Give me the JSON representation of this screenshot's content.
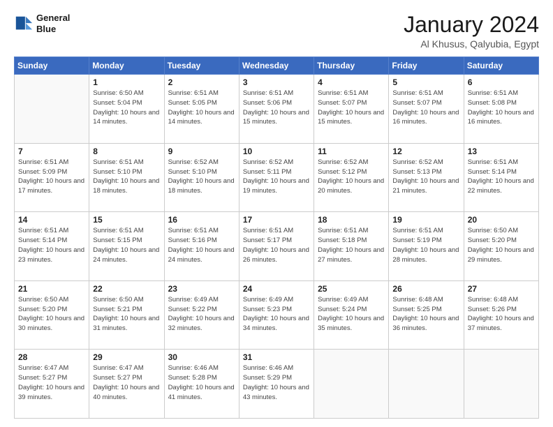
{
  "header": {
    "logo_line1": "General",
    "logo_line2": "Blue",
    "title": "January 2024",
    "subtitle": "Al Khusus, Qalyubia, Egypt"
  },
  "calendar": {
    "days_of_week": [
      "Sunday",
      "Monday",
      "Tuesday",
      "Wednesday",
      "Thursday",
      "Friday",
      "Saturday"
    ],
    "weeks": [
      [
        {
          "day": null,
          "info": null
        },
        {
          "day": "1",
          "info": "Sunrise: 6:50 AM\nSunset: 5:04 PM\nDaylight: 10 hours\nand 14 minutes."
        },
        {
          "day": "2",
          "info": "Sunrise: 6:51 AM\nSunset: 5:05 PM\nDaylight: 10 hours\nand 14 minutes."
        },
        {
          "day": "3",
          "info": "Sunrise: 6:51 AM\nSunset: 5:06 PM\nDaylight: 10 hours\nand 15 minutes."
        },
        {
          "day": "4",
          "info": "Sunrise: 6:51 AM\nSunset: 5:07 PM\nDaylight: 10 hours\nand 15 minutes."
        },
        {
          "day": "5",
          "info": "Sunrise: 6:51 AM\nSunset: 5:07 PM\nDaylight: 10 hours\nand 16 minutes."
        },
        {
          "day": "6",
          "info": "Sunrise: 6:51 AM\nSunset: 5:08 PM\nDaylight: 10 hours\nand 16 minutes."
        }
      ],
      [
        {
          "day": "7",
          "info": "Sunrise: 6:51 AM\nSunset: 5:09 PM\nDaylight: 10 hours\nand 17 minutes."
        },
        {
          "day": "8",
          "info": "Sunrise: 6:51 AM\nSunset: 5:10 PM\nDaylight: 10 hours\nand 18 minutes."
        },
        {
          "day": "9",
          "info": "Sunrise: 6:52 AM\nSunset: 5:10 PM\nDaylight: 10 hours\nand 18 minutes."
        },
        {
          "day": "10",
          "info": "Sunrise: 6:52 AM\nSunset: 5:11 PM\nDaylight: 10 hours\nand 19 minutes."
        },
        {
          "day": "11",
          "info": "Sunrise: 6:52 AM\nSunset: 5:12 PM\nDaylight: 10 hours\nand 20 minutes."
        },
        {
          "day": "12",
          "info": "Sunrise: 6:52 AM\nSunset: 5:13 PM\nDaylight: 10 hours\nand 21 minutes."
        },
        {
          "day": "13",
          "info": "Sunrise: 6:51 AM\nSunset: 5:14 PM\nDaylight: 10 hours\nand 22 minutes."
        }
      ],
      [
        {
          "day": "14",
          "info": "Sunrise: 6:51 AM\nSunset: 5:14 PM\nDaylight: 10 hours\nand 23 minutes."
        },
        {
          "day": "15",
          "info": "Sunrise: 6:51 AM\nSunset: 5:15 PM\nDaylight: 10 hours\nand 24 minutes."
        },
        {
          "day": "16",
          "info": "Sunrise: 6:51 AM\nSunset: 5:16 PM\nDaylight: 10 hours\nand 24 minutes."
        },
        {
          "day": "17",
          "info": "Sunrise: 6:51 AM\nSunset: 5:17 PM\nDaylight: 10 hours\nand 26 minutes."
        },
        {
          "day": "18",
          "info": "Sunrise: 6:51 AM\nSunset: 5:18 PM\nDaylight: 10 hours\nand 27 minutes."
        },
        {
          "day": "19",
          "info": "Sunrise: 6:51 AM\nSunset: 5:19 PM\nDaylight: 10 hours\nand 28 minutes."
        },
        {
          "day": "20",
          "info": "Sunrise: 6:50 AM\nSunset: 5:20 PM\nDaylight: 10 hours\nand 29 minutes."
        }
      ],
      [
        {
          "day": "21",
          "info": "Sunrise: 6:50 AM\nSunset: 5:20 PM\nDaylight: 10 hours\nand 30 minutes."
        },
        {
          "day": "22",
          "info": "Sunrise: 6:50 AM\nSunset: 5:21 PM\nDaylight: 10 hours\nand 31 minutes."
        },
        {
          "day": "23",
          "info": "Sunrise: 6:49 AM\nSunset: 5:22 PM\nDaylight: 10 hours\nand 32 minutes."
        },
        {
          "day": "24",
          "info": "Sunrise: 6:49 AM\nSunset: 5:23 PM\nDaylight: 10 hours\nand 34 minutes."
        },
        {
          "day": "25",
          "info": "Sunrise: 6:49 AM\nSunset: 5:24 PM\nDaylight: 10 hours\nand 35 minutes."
        },
        {
          "day": "26",
          "info": "Sunrise: 6:48 AM\nSunset: 5:25 PM\nDaylight: 10 hours\nand 36 minutes."
        },
        {
          "day": "27",
          "info": "Sunrise: 6:48 AM\nSunset: 5:26 PM\nDaylight: 10 hours\nand 37 minutes."
        }
      ],
      [
        {
          "day": "28",
          "info": "Sunrise: 6:47 AM\nSunset: 5:27 PM\nDaylight: 10 hours\nand 39 minutes."
        },
        {
          "day": "29",
          "info": "Sunrise: 6:47 AM\nSunset: 5:27 PM\nDaylight: 10 hours\nand 40 minutes."
        },
        {
          "day": "30",
          "info": "Sunrise: 6:46 AM\nSunset: 5:28 PM\nDaylight: 10 hours\nand 41 minutes."
        },
        {
          "day": "31",
          "info": "Sunrise: 6:46 AM\nSunset: 5:29 PM\nDaylight: 10 hours\nand 43 minutes."
        },
        {
          "day": null,
          "info": null
        },
        {
          "day": null,
          "info": null
        },
        {
          "day": null,
          "info": null
        }
      ]
    ]
  }
}
